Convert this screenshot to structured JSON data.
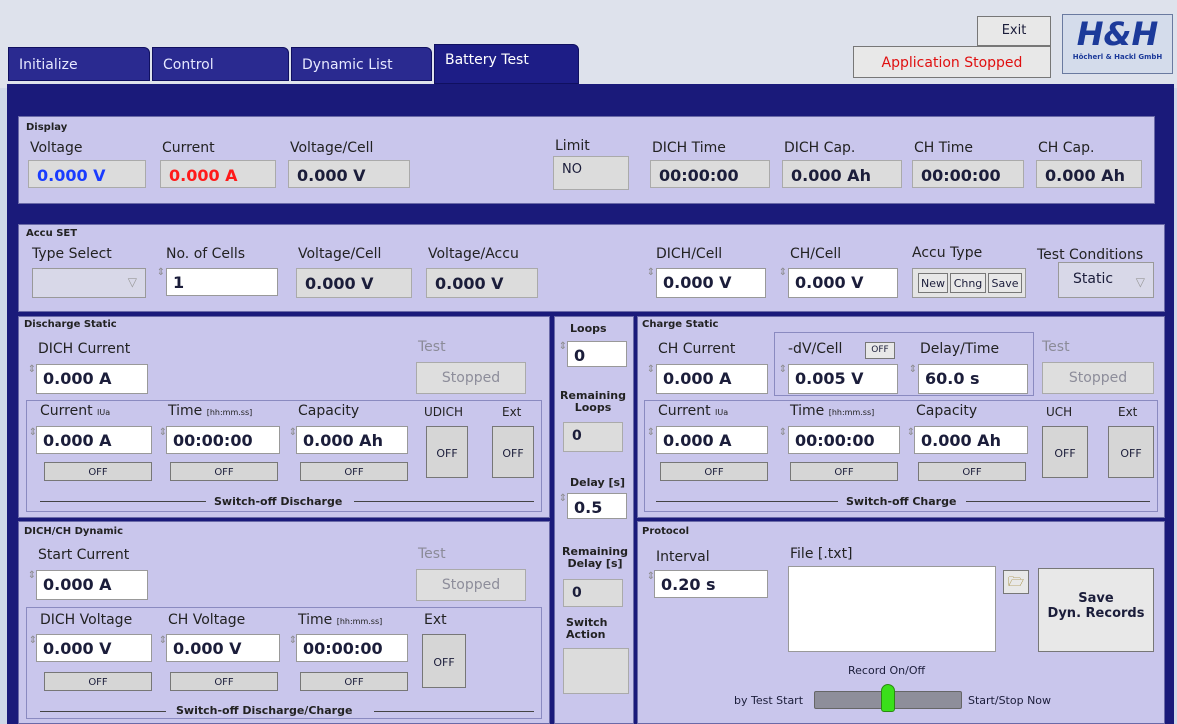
{
  "tabs": [
    "Initialize",
    "Control",
    "Dynamic List",
    "Battery Test"
  ],
  "exit_label": "Exit",
  "app_status": "Application Stopped",
  "logo_text": "H&H",
  "logo_sub": "Höcherl & Hackl GmbH",
  "colors": {
    "status_red": "#e01010",
    "voltage_blue": "#1a3cff",
    "current_red": "#ff1a1a",
    "panel": "#c9c6ec",
    "background": "#1a1a7a"
  },
  "display": {
    "title": "Display",
    "voltage_label": "Voltage",
    "voltage": "0.000 V",
    "current_label": "Current",
    "current": "0.000 A",
    "vcell_label": "Voltage/Cell",
    "vcell": "0.000 V",
    "limit_label": "Limit",
    "limit": "NO",
    "dich_time_label": "DICH Time",
    "dich_time": "00:00:00",
    "dich_cap_label": "DICH Cap.",
    "dich_cap": "0.000 Ah",
    "ch_time_label": "CH Time",
    "ch_time": "00:00:00",
    "ch_cap_label": "CH Cap.",
    "ch_cap": "0.000 Ah"
  },
  "accu": {
    "title": "Accu SET",
    "type_label": "Type Select",
    "cells_label": "No. of Cells",
    "cells": "1",
    "vcell_label": "Voltage/Cell",
    "vcell": "0.000 V",
    "vaccu_label": "Voltage/Accu",
    "vaccu": "0.000 V",
    "dich_label": "DICH/Cell",
    "dich": "0.000 V",
    "ch_label": "CH/Cell",
    "ch": "0.000 V",
    "type2_label": "Accu Type",
    "new": "New",
    "chng": "Chng",
    "save": "Save",
    "cond_label": "Test Conditions",
    "cond": "Static"
  },
  "dstatic": {
    "title": "Discharge Static",
    "current_label": "DICH Current",
    "current": "0.000 A",
    "test_label": "Test",
    "test": "Stopped",
    "cur_label": "Current",
    "cur_sub": "IUa",
    "cur": "0.000 A",
    "time_label": "Time",
    "time_sub": "[hh:mm.ss]",
    "time": "00:00:00",
    "cap_label": "Capacity",
    "cap": "0.000 Ah",
    "u_label": "UDICH",
    "ext_label": "Ext",
    "off": "OFF",
    "footer": "Switch-off Discharge"
  },
  "loops": {
    "loops_label": "Loops",
    "loops": "0",
    "rem_label": "Remaining Loops",
    "rem": "0",
    "delay_label": "Delay [s]",
    "delay": "0.5",
    "remdelay_label": "Remaining Delay [s]",
    "remdelay": "0",
    "switch_label": "Switch Action"
  },
  "cstatic": {
    "title": "Charge Static",
    "current_label": "CH Current",
    "current": "0.000 A",
    "dv_label": "-dV/Cell",
    "dv_off": "OFF",
    "dv": "0.005 V",
    "delay_label": "Delay/Time",
    "delay": "60.0 s",
    "test_label": "Test",
    "test": "Stopped",
    "cur_label": "Current",
    "cur_sub": "IUa",
    "cur": "0.000 A",
    "time_label": "Time",
    "time_sub": "[hh:mm.ss]",
    "time": "00:00:00",
    "cap_label": "Capacity",
    "cap": "0.000 Ah",
    "u_label": "UCH",
    "ext_label": "Ext",
    "off": "OFF",
    "footer": "Switch-off Charge"
  },
  "dynamic": {
    "title": "DICH/CH Dynamic",
    "start_label": "Start Current",
    "start": "0.000 A",
    "test_label": "Test",
    "test": "Stopped",
    "dv_label": "DICH Voltage",
    "dv": "0.000 V",
    "cv_label": "CH Voltage",
    "cv": "0.000 V",
    "time_label": "Time",
    "time_sub": "[hh:mm.ss]",
    "time": "00:00:00",
    "ext_label": "Ext",
    "off": "OFF",
    "footer": "Switch-off Discharge/Charge"
  },
  "protocol": {
    "title": "Protocol",
    "interval_label": "Interval",
    "interval": "0.20 s",
    "file_label": "File [.txt]",
    "save": "Save\nDyn. Records",
    "record_label": "Record On/Off",
    "left": "by Test Start",
    "right": "Start/Stop Now",
    "switch_position": 0.5
  }
}
